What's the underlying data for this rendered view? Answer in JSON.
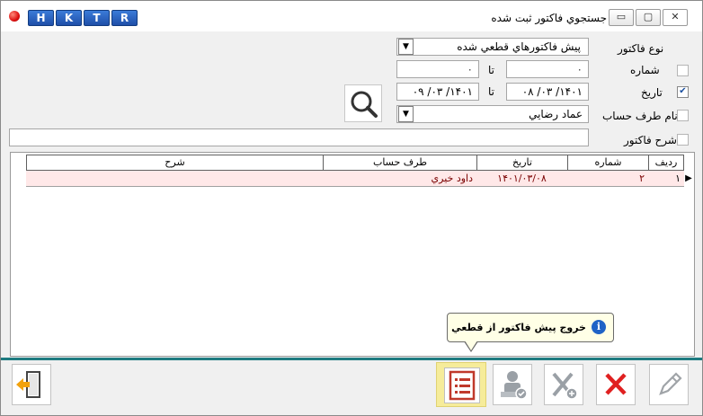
{
  "title_bar": {
    "title": "جستجوي فاكتور ثبت شده",
    "quick_buttons": [
      "H",
      "K",
      "T",
      "R"
    ],
    "controls": {
      "minimize": "▭",
      "maximize": "▢",
      "close": "✕"
    }
  },
  "filters": {
    "invoice_type": {
      "label": "نوع فاكتور",
      "value": "پيش فاكتورهاي قطعي شده"
    },
    "number": {
      "label": "شماره",
      "from": "۰",
      "to_label": "تا",
      "to": "۰",
      "checked": false
    },
    "date": {
      "label": "تاريخ",
      "from": "۱۴۰۱/ ۰۳/ ۰۸",
      "to_label": "تا",
      "to": "۱۴۰۱/ ۰۳/ ۰۹",
      "checked": true
    },
    "account_party": {
      "label": "نام طرف حساب",
      "value": "عماد رضايي",
      "checked": false
    },
    "description": {
      "label": "شرح فاكتور",
      "value": "",
      "checked": false
    }
  },
  "grid": {
    "columns": [
      "رديف",
      "شماره",
      "تاريخ",
      "طرف حساب",
      "شرح"
    ],
    "rows": [
      {
        "row": "۱",
        "number": "۲",
        "date": "۱۴۰۱/۰۳/۰۸",
        "party": "داود خيري",
        "description": ""
      }
    ]
  },
  "tooltip": {
    "text": "خروج پيش فاكتور از قطعي",
    "icon": "info-icon"
  },
  "toolbar": {
    "icons": [
      "exit-icon",
      "list-icon",
      "user-stamp-icon",
      "cancel-tools-icon",
      "delete-icon",
      "edit-icon"
    ],
    "accent": "#1e7b80",
    "highlight": "#f6ec9a"
  }
}
